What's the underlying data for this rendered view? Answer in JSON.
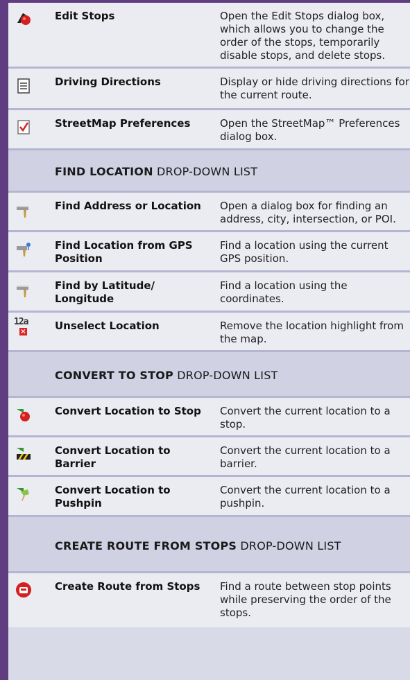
{
  "rows_top": [
    {
      "icon": "edit-stops-icon",
      "name": "Edit Stops",
      "desc": "Open the Edit Stops dialog box, which allows you to change the order of the stops, temporarily disable stops, and delete stops."
    },
    {
      "icon": "driving-directions-icon",
      "name": "Driving Directions",
      "desc": "Display or hide driving directions for the current route."
    },
    {
      "icon": "streetmap-preferences-icon",
      "name": "StreetMap Preferences",
      "desc": "Open the StreetMap™ Preferences dialog box."
    }
  ],
  "sections": [
    {
      "heading_bold": "FIND LOCATION",
      "heading_rest": " DROP-DOWN LIST",
      "rows": [
        {
          "icon": "find-address-icon",
          "name": "Find Address or Location",
          "desc": "Open a dialog box for finding an address, city, intersection, or POI."
        },
        {
          "icon": "find-gps-icon",
          "name": "Find Location from GPS Position",
          "desc": "Find a location using the current GPS position."
        },
        {
          "icon": "find-latlong-icon",
          "name": "Find by Latitude/ Longitude",
          "desc": "Find a location using the coordinates."
        },
        {
          "icon": "unselect-location-icon",
          "icon_text": "12a",
          "name": "Unselect Location",
          "desc": "Remove the location highlight from the map."
        }
      ]
    },
    {
      "heading_bold": "CONVERT TO STOP",
      "heading_rest": " DROP-DOWN LIST",
      "rows": [
        {
          "icon": "convert-to-stop-icon",
          "name": "Convert Location to Stop",
          "desc": "Convert the current location to a stop."
        },
        {
          "icon": "convert-to-barrier-icon",
          "name": "Convert Location to Barrier",
          "desc": "Convert the current location to a barrier."
        },
        {
          "icon": "convert-to-pushpin-icon",
          "name": "Convert Location to Pushpin",
          "desc": "Convert the current location to a pushpin."
        }
      ]
    },
    {
      "heading_bold": "CREATE ROUTE FROM STOPS",
      "heading_rest": " DROP-DOWN LIST",
      "rows": [
        {
          "icon": "create-route-icon",
          "name": "Create Route from Stops",
          "desc": "Find a route between stop points while preserving the order of the stops."
        }
      ]
    }
  ]
}
